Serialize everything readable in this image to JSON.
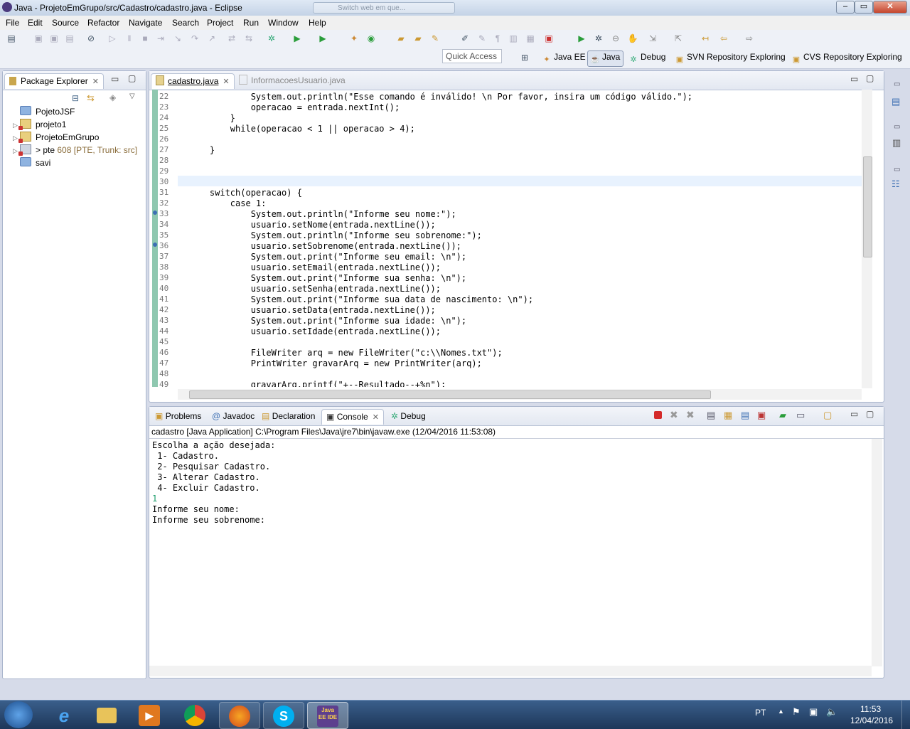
{
  "window": {
    "title": "Java - ProjetoEmGrupo/src/Cadastro/cadastro.java - Eclipse",
    "ghost_tab": "Switch web em que...",
    "minimize": "–",
    "restore": "▭",
    "close": "✕"
  },
  "menu": [
    "File",
    "Edit",
    "Source",
    "Refactor",
    "Navigate",
    "Search",
    "Project",
    "Run",
    "Window",
    "Help"
  ],
  "quick_access": "Quick Access",
  "perspectives": [
    "Java EE",
    "Java",
    "Debug",
    "SVN Repository Exploring",
    "CVS Repository Exploring"
  ],
  "explorer": {
    "title": "Package Explorer",
    "items": [
      {
        "name": "PojetoJSF",
        "decor": ""
      },
      {
        "name": "projeto1",
        "decor": ""
      },
      {
        "name": "ProjetoEmGrupo",
        "decor": ""
      },
      {
        "name": "> pte",
        "decor": "608 [PTE, Trunk: src]"
      },
      {
        "name": "savi",
        "decor": ""
      }
    ]
  },
  "editor": {
    "tabs": [
      "cadastro.java",
      "InformacoesUsuario.java"
    ],
    "lines": [
      {
        "n": "22",
        "t": "            System.out.println(\"Esse comando é inválido! \\n Por favor, insira um código válido.\");"
      },
      {
        "n": "23",
        "t": "            operacao = entrada.nextInt();"
      },
      {
        "n": "24",
        "t": "        }"
      },
      {
        "n": "25",
        "t": "        while(operacao < 1 || operacao > 4);"
      },
      {
        "n": "26",
        "t": ""
      },
      {
        "n": "27",
        "t": "    }"
      },
      {
        "n": "28",
        "t": ""
      },
      {
        "n": "29",
        "t": ""
      },
      {
        "n": "30",
        "t": ""
      },
      {
        "n": "31",
        "t": "    switch(operacao) {"
      },
      {
        "n": "32",
        "t": "        case 1:"
      },
      {
        "n": "33",
        "t": "            System.out.println(\"Informe seu nome:\");"
      },
      {
        "n": "34",
        "t": "            usuario.setNome(entrada.nextLine());"
      },
      {
        "n": "35",
        "t": "            System.out.println(\"Informe seu sobrenome:\");"
      },
      {
        "n": "36",
        "t": "            usuario.setSobrenome(entrada.nextLine());"
      },
      {
        "n": "37",
        "t": "            System.out.print(\"Informe seu email: \\n\");"
      },
      {
        "n": "38",
        "t": "            usuario.setEmail(entrada.nextLine());"
      },
      {
        "n": "39",
        "t": "            System.out.print(\"Informe sua senha: \\n\");"
      },
      {
        "n": "40",
        "t": "            usuario.setSenha(entrada.nextLine());"
      },
      {
        "n": "41",
        "t": "            System.out.print(\"Informe sua data de nascimento: \\n\");"
      },
      {
        "n": "42",
        "t": "            usuario.setData(entrada.nextLine());"
      },
      {
        "n": "43",
        "t": "            System.out.print(\"Informe sua idade: \\n\");"
      },
      {
        "n": "44",
        "t": "            usuario.setIdade(entrada.nextLine());"
      },
      {
        "n": "45",
        "t": ""
      },
      {
        "n": "46",
        "t": "            FileWriter arq = new FileWriter(\"c:\\\\Nomes.txt\");"
      },
      {
        "n": "47",
        "t": "            PrintWriter gravarArq = new PrintWriter(arq);"
      },
      {
        "n": "48",
        "t": ""
      },
      {
        "n": "49",
        "t": "            gravarArq.printf(\"+--Resultado--+%n\");"
      }
    ]
  },
  "bottom": {
    "tabs": [
      "Problems",
      "Javadoc",
      "Declaration",
      "Console",
      "Debug"
    ],
    "launch": "cadastro [Java Application] C:\\Program Files\\Java\\jre7\\bin\\javaw.exe (12/04/2016 11:53:08)",
    "output": [
      "Escolha a ação desejada:",
      " 1- Cadastro.",
      " 2- Pesquisar Cadastro.",
      " 3- Alterar Cadastro.",
      " 4- Excluir Cadastro.",
      "1",
      "Informe seu nome:",
      "Informe seu sobrenome:"
    ]
  },
  "taskbar": {
    "lang": "PT",
    "time": "11:53",
    "date": "12/04/2016",
    "javaee_label": "Java EE IDE"
  }
}
